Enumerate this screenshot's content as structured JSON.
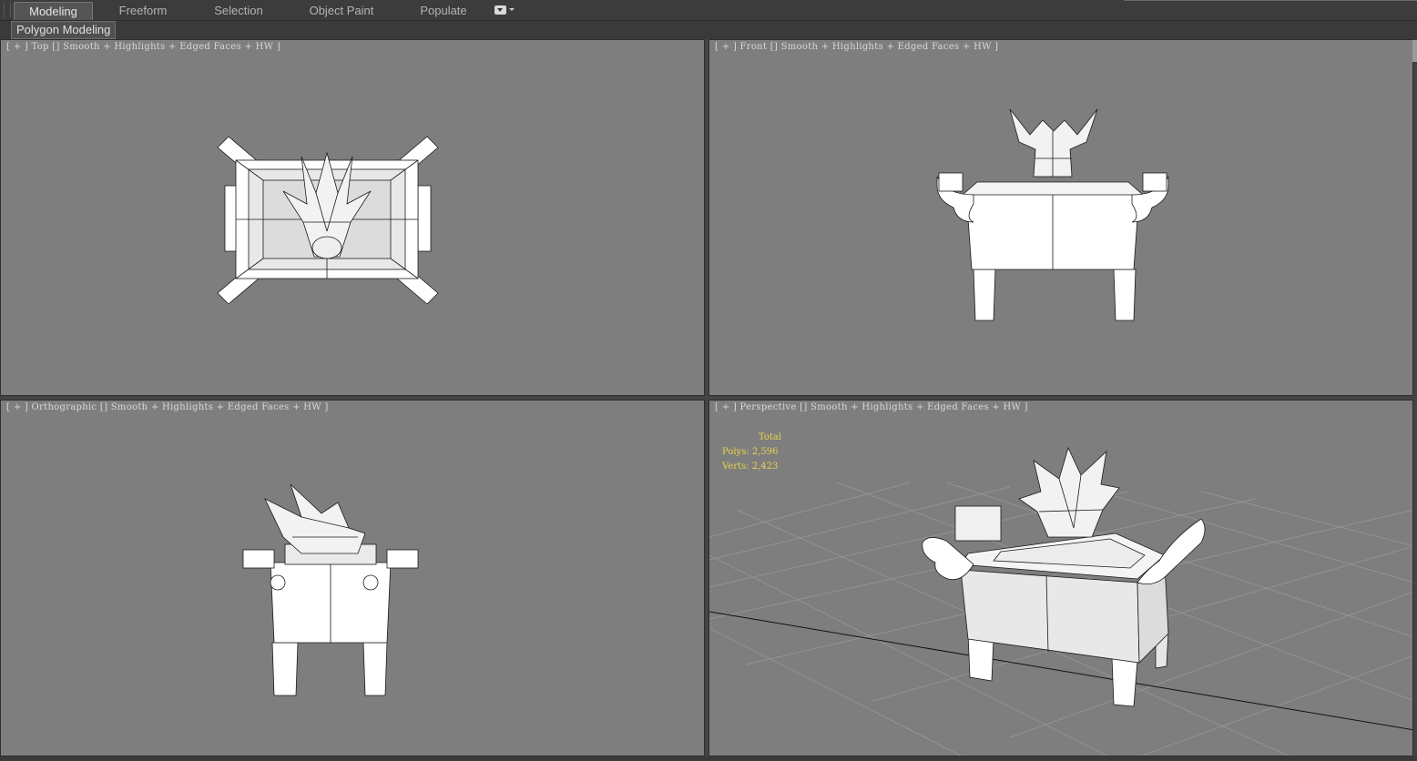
{
  "ribbon": {
    "tabs": [
      {
        "label": "Modeling",
        "active": true
      },
      {
        "label": "Freeform",
        "active": false
      },
      {
        "label": "Selection",
        "active": false
      },
      {
        "label": "Object Paint",
        "active": false
      },
      {
        "label": "Populate",
        "active": false
      }
    ],
    "panel_button": "Polygon Modeling"
  },
  "viewports": [
    {
      "view": "Top",
      "shading": "Smooth + Highlights + Edged Faces + HW"
    },
    {
      "view": "Front",
      "shading": "Smooth + Highlights + Edged Faces + HW"
    },
    {
      "view": "Orthographic",
      "shading": "Smooth + Highlights + Edged Faces + HW"
    },
    {
      "view": "Perspective",
      "shading": "Smooth + Highlights + Edged Faces + HW"
    }
  ],
  "stats": {
    "total_label": "Total",
    "polys_label": "Polys:",
    "polys": "2,596",
    "verts_label": "Verts:",
    "verts": "2,423"
  },
  "colors": {
    "viewport_bg": "#7e7e7e",
    "ui_bg": "#444444",
    "stats_text": "#e8d34a",
    "model_fill": "#ffffff",
    "wire": "#1a1a1a"
  }
}
